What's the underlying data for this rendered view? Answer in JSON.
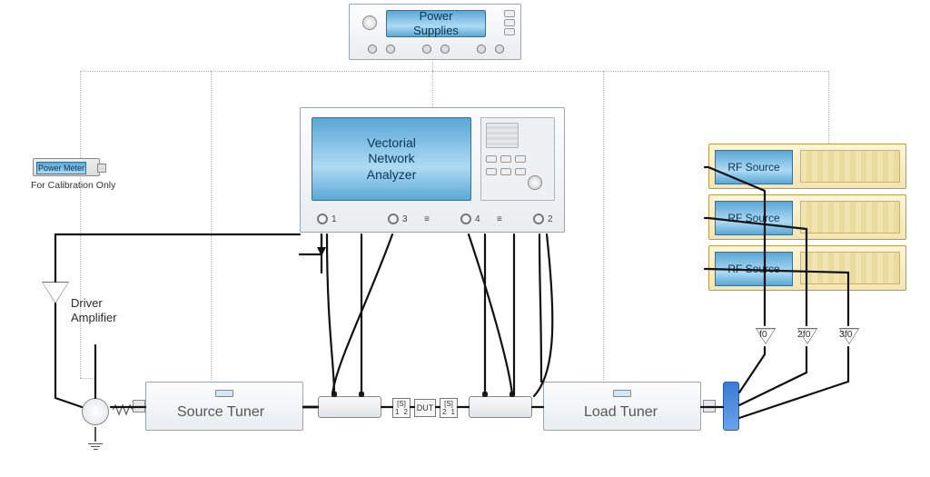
{
  "power_supplies": {
    "label": "Power\nSupplies"
  },
  "vna": {
    "label": "Vectorial\nNetwork\nAnalyzer",
    "ports": [
      "1",
      "3",
      "4",
      "2"
    ]
  },
  "power_meter": {
    "label": "Power Meter",
    "footnote": "For Calibration Only"
  },
  "driver_amp": {
    "label": "Driver\nAmplifier"
  },
  "source_tuner": {
    "label": "Source Tuner"
  },
  "load_tuner": {
    "label": "Load Tuner"
  },
  "dut": {
    "label": "DUT"
  },
  "s_left": {
    "top": "[S]",
    "bl": "1",
    "br": "2"
  },
  "s_right": {
    "top": "[S]",
    "bl": "2",
    "br": "1"
  },
  "rf_sources": [
    {
      "label": "RF Source"
    },
    {
      "label": "RF Source"
    },
    {
      "label": "RF Source"
    }
  ],
  "harmonics": {
    "h1": "f0",
    "h2": "2f0",
    "h3": "3f0"
  }
}
